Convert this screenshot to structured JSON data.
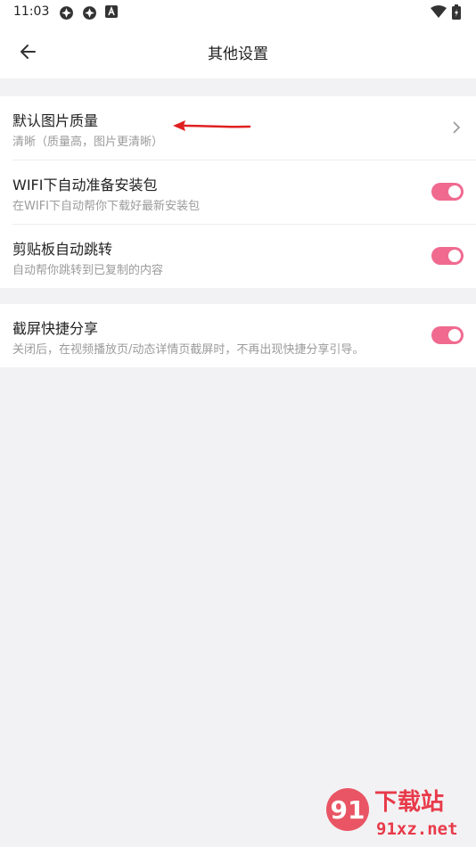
{
  "status": {
    "time": "11:03",
    "icons": [
      "app-icon",
      "app-icon",
      "notification-a-icon",
      "wifi-icon",
      "battery-icon"
    ]
  },
  "header": {
    "title": "其他设置"
  },
  "settings": {
    "image_quality": {
      "title": "默认图片质量",
      "subtitle": "清晰（质量高，图片更清晰）"
    },
    "wifi_download": {
      "title": "WIFI下自动准备安装包",
      "subtitle": "在WIFI下自动帮你下载好最新安装包",
      "enabled": true
    },
    "clipboard_jump": {
      "title": "剪贴板自动跳转",
      "subtitle": "自动帮你跳转到已复制的内容",
      "enabled": true
    },
    "screenshot_share": {
      "title": "截屏快捷分享",
      "subtitle": "关闭后，在视频播放页/动态详情页截屏时，不再出现快捷分享引导。",
      "enabled": true
    }
  },
  "colors": {
    "accent": "#f06a8f",
    "background": "#f2f2f4",
    "annotation_arrow": "#e02020"
  },
  "watermark": {
    "brand_text": "下载站",
    "domain_text": "91xz.net"
  }
}
